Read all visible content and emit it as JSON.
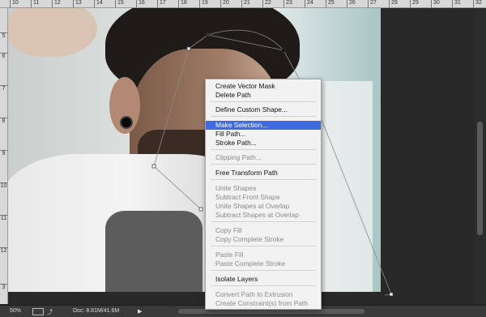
{
  "rulers": {
    "top": [
      "10",
      "11",
      "12",
      "13",
      "14",
      "15",
      "16",
      "17",
      "18",
      "19",
      "20",
      "21",
      "22",
      "23",
      "24",
      "25",
      "26",
      "27",
      "28",
      "29",
      "30",
      "31",
      "32"
    ],
    "left": [
      "5",
      "6",
      "7",
      "8",
      "9",
      "10",
      "11",
      "12",
      "3"
    ]
  },
  "status_bar": {
    "zoom": "50%",
    "doc_info": "Doc: 8.81M/41.6M",
    "arrow": "▶"
  },
  "context_menu": {
    "items": [
      {
        "label": "Create Vector Mask",
        "disabled": false
      },
      {
        "label": "Delete Path",
        "disabled": false
      },
      {
        "label": "Define Custom Shape...",
        "disabled": false
      },
      {
        "label": "Make Selection...",
        "disabled": false,
        "highlighted": true
      },
      {
        "label": "Fill Path...",
        "disabled": false
      },
      {
        "label": "Stroke Path...",
        "disabled": false
      },
      {
        "label": "Clipping Path...",
        "disabled": true
      },
      {
        "label": "Free Transform Path",
        "disabled": false
      },
      {
        "label": "Unite Shapes",
        "disabled": true
      },
      {
        "label": "Subtract Front Shape",
        "disabled": true
      },
      {
        "label": "Unite Shapes at Overlap",
        "disabled": true
      },
      {
        "label": "Subtract Shapes at Overlap",
        "disabled": true
      },
      {
        "label": "Copy Fill",
        "disabled": true
      },
      {
        "label": "Copy Complete Stroke",
        "disabled": true
      },
      {
        "label": "Paste Fill",
        "disabled": true
      },
      {
        "label": "Paste Complete Stroke",
        "disabled": true
      },
      {
        "label": "Isolate Layers",
        "disabled": false
      },
      {
        "label": "Convert Path to Extrusion",
        "disabled": true
      },
      {
        "label": "Create Constraint(s) from Path",
        "disabled": true
      }
    ]
  },
  "colors": {
    "highlight": "#3f6be0",
    "menu_bg": "#f2f2f2",
    "app_bg": "#282828"
  }
}
